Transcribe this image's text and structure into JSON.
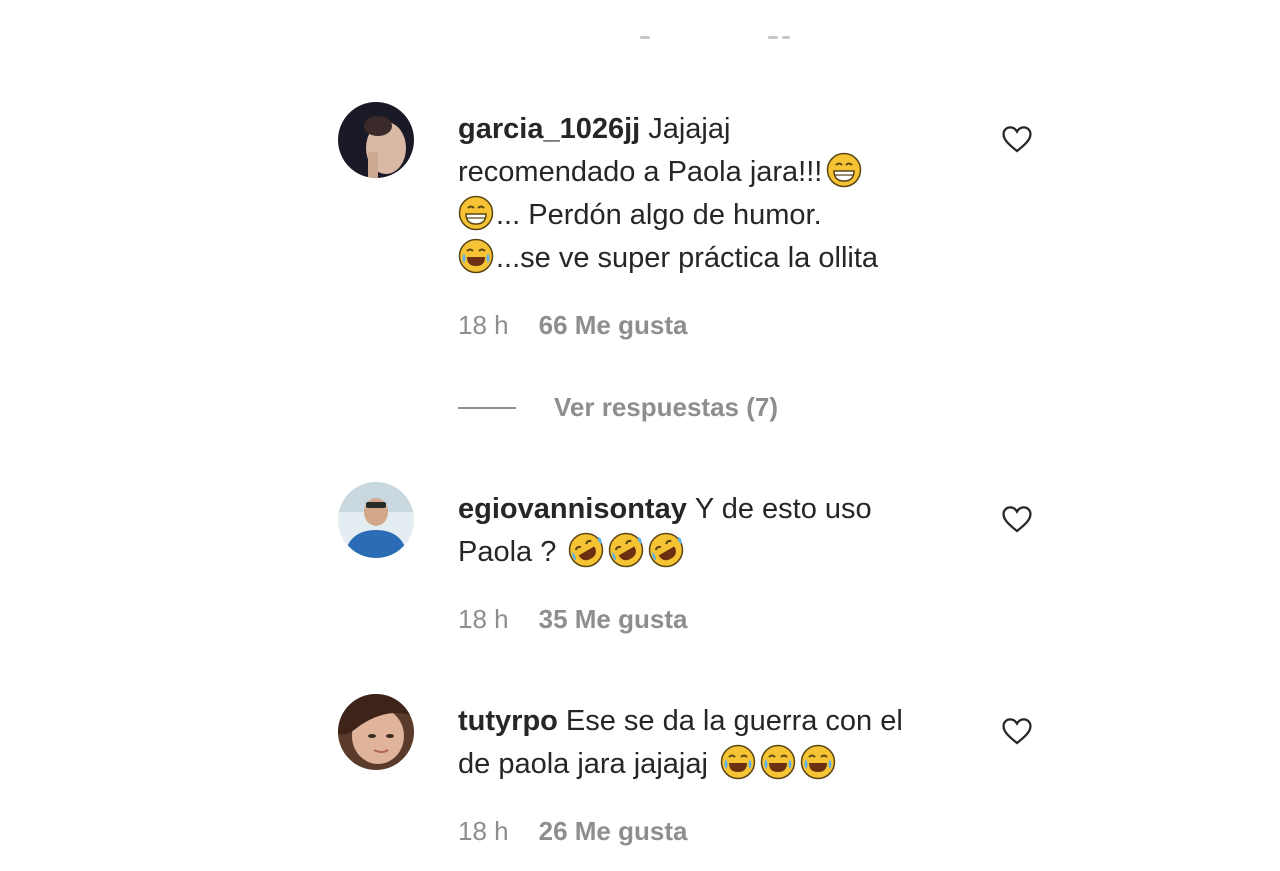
{
  "comments": [
    {
      "username": "garcia_1026jj",
      "lines": [
        {
          "text": "Jajajaj",
          "emoji_after": []
        },
        {
          "text": "recomendado a Paola jara!!!",
          "emoji_after": [
            "grin"
          ]
        },
        {
          "text": "... Perdón algo de humor.",
          "emoji_before": [
            "grin"
          ]
        },
        {
          "text": "...se ve super práctica la ollita",
          "emoji_before": [
            "joy"
          ]
        }
      ],
      "time": "18 h",
      "likes": "66 Me gusta"
    },
    {
      "username": "egiovannisontay",
      "text_1": "Y de esto uso",
      "text_2": "Paola ?",
      "emoji": [
        "rofl",
        "rofl",
        "rofl"
      ],
      "time": "18 h",
      "likes": "35 Me gusta"
    },
    {
      "username": "tutyrpo",
      "text_1": "Ese se da la guerra con el",
      "text_2": "de paola jara jajajaj",
      "emoji": [
        "joy",
        "joy",
        "joy"
      ],
      "time": "18 h",
      "likes": "26 Me gusta"
    }
  ],
  "view_replies": "Ver respuestas (7)",
  "icons": {
    "like": "heart-outline-icon"
  },
  "colors": {
    "text": "#262626",
    "secondary": "#8e8e8e"
  }
}
